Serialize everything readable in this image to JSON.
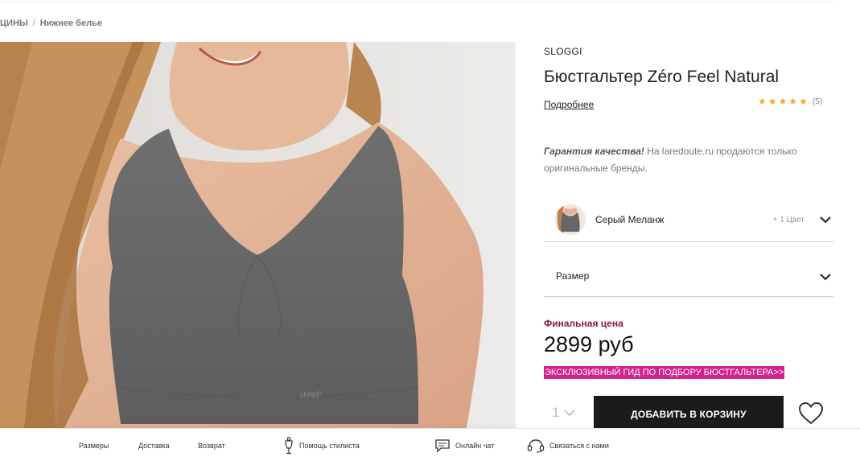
{
  "breadcrumb": {
    "prev": "ЦИНЫ",
    "separator": "/",
    "current": "Нижнее белье"
  },
  "product": {
    "brand": "SLOGGI",
    "title": "Бюстгальтер Zéro Feel Natural",
    "more_link": "Подробнее",
    "rating": {
      "stars": 5,
      "count_label": "(5)"
    },
    "image_logo_text": "sloggi"
  },
  "guarantee": {
    "bold": "Гарантия качества!",
    "text": " На laredoute.ru продаются только оригинальные бренды."
  },
  "color_selector": {
    "value": "Серый Меланж",
    "extra": "+ 1 Цвет",
    "icon": "chevron-down-icon"
  },
  "size_selector": {
    "label": "Размер",
    "icon": "chevron-down-icon"
  },
  "pricing": {
    "final_label": "Финальная цена",
    "price": "2899 руб",
    "guide_banner": "ЭКСКЛЮЗИВНЫЙ ГИД ПО ПОДБОРУ БЮСТГАЛЬТЕРА>>"
  },
  "purchase": {
    "quantity": "1",
    "add_to_cart": "ДОБАВИТЬ В КОРЗИНУ",
    "wishlist_icon": "heart-icon"
  },
  "bottom_bar": {
    "sizes": "Размеры",
    "delivery": "Доставка",
    "returns": "Возврат",
    "stylist": "Помощь стилиста",
    "chat": "Онлайн чат",
    "contact": "Связаться с нами"
  },
  "colors": {
    "brand_magenta": "#d1228d",
    "final_label": "#8b1745",
    "star": "#f2a832",
    "button_bg": "#1b1b1b"
  }
}
